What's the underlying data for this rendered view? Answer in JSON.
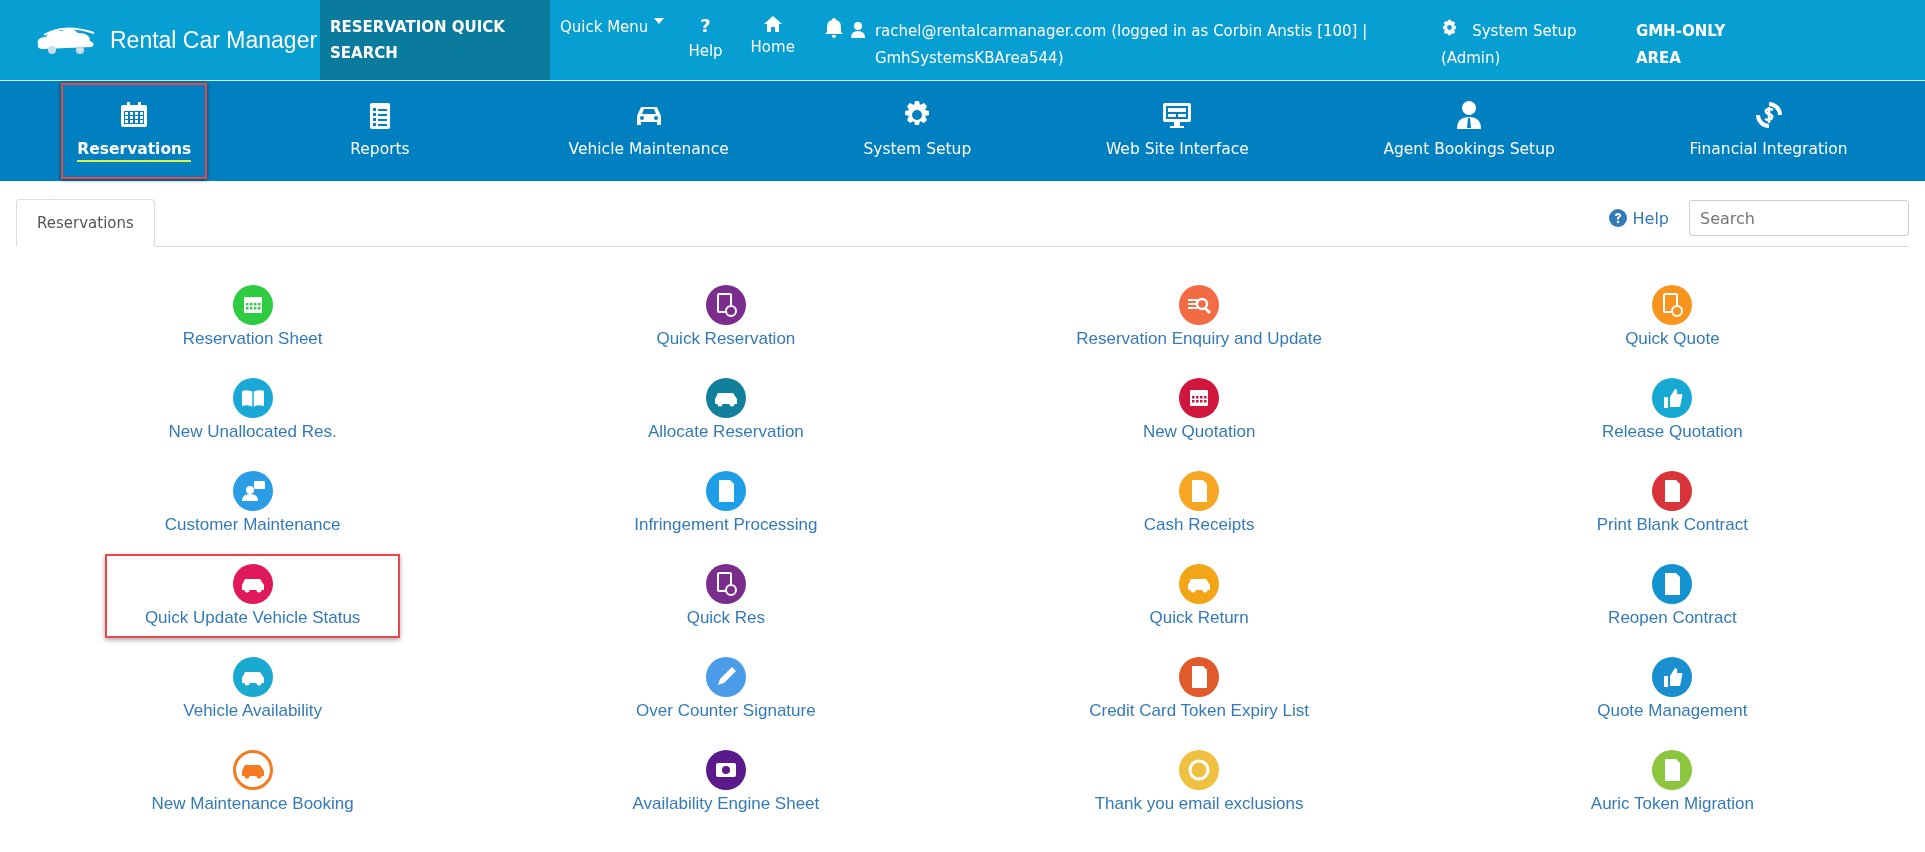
{
  "topbar": {
    "brand": "Rental Car Manager",
    "quick_search": "RESERVATION QUICK SEARCH",
    "quick_menu": "Quick Menu",
    "help_glyph": "?",
    "help": "Help",
    "home": "Home",
    "user": "rachel@rentalcarmanager.com (logged in as Corbin Anstis [100] | GmhSystemsKBArea544)",
    "system_setup": "System Setup (Admin)",
    "area": "GMH-ONLY AREA"
  },
  "nav": [
    {
      "label": "Reservations",
      "selected": true,
      "highlighted": true
    },
    {
      "label": "Reports",
      "selected": false,
      "highlighted": false
    },
    {
      "label": "Vehicle Maintenance",
      "selected": false,
      "highlighted": false
    },
    {
      "label": "System Setup",
      "selected": false,
      "highlighted": false
    },
    {
      "label": "Web Site Interface",
      "selected": false,
      "highlighted": false
    },
    {
      "label": "Agent Bookings Setup",
      "selected": false,
      "highlighted": false
    },
    {
      "label": "Financial Integration",
      "selected": false,
      "highlighted": false
    }
  ],
  "tabs": [
    {
      "label": "Reservations",
      "selected": true
    }
  ],
  "help_link": "Help",
  "search": {
    "placeholder": "Search"
  },
  "menu": [
    [
      {
        "label": "Reservation Sheet",
        "color": "#2ecc40",
        "highlighted": false
      },
      {
        "label": "New Unallocated Res.",
        "color": "#1aa9d6",
        "highlighted": false
      },
      {
        "label": "Customer Maintenance",
        "color": "#2a9de6",
        "highlighted": false
      },
      {
        "label": "Quick Update Vehicle Status",
        "color": "#e0195a",
        "highlighted": true
      },
      {
        "label": "Vehicle Availability",
        "color": "#1aa9d0",
        "highlighted": false
      },
      {
        "label": "New Maintenance Booking",
        "color": "#f47b20",
        "highlighted": false
      }
    ],
    [
      {
        "label": "Quick Reservation",
        "color": "#7b2d8e",
        "highlighted": false
      },
      {
        "label": "Allocate Reservation",
        "color": "#127f9c",
        "highlighted": false
      },
      {
        "label": "Infringement Processing",
        "color": "#1f9ee8",
        "highlighted": false
      },
      {
        "label": "Quick Res",
        "color": "#7b2d8e",
        "highlighted": false
      },
      {
        "label": "Over Counter Signature",
        "color": "#4a9be8",
        "highlighted": false
      },
      {
        "label": "Availability Engine Sheet",
        "color": "#5b1a8c",
        "highlighted": false
      }
    ],
    [
      {
        "label": "Reservation Enquiry and Update",
        "color": "#f26b45",
        "highlighted": false
      },
      {
        "label": "New Quotation",
        "color": "#d0163c",
        "highlighted": false
      },
      {
        "label": "Cash Receipts",
        "color": "#f6a623",
        "highlighted": false
      },
      {
        "label": "Quick Return",
        "color": "#f2a516",
        "highlighted": false
      },
      {
        "label": "Credit Card Token Expiry List",
        "color": "#e05a2b",
        "highlighted": false
      },
      {
        "label": "Thank you email exclusions",
        "color": "#f0c040",
        "highlighted": false
      }
    ],
    [
      {
        "label": "Quick Quote",
        "color": "#f7941d",
        "highlighted": false
      },
      {
        "label": "Release Quotation",
        "color": "#16a9d1",
        "highlighted": false
      },
      {
        "label": "Print Blank Contract",
        "color": "#d9343a",
        "highlighted": false
      },
      {
        "label": "Reopen Contract",
        "color": "#1491cf",
        "highlighted": false
      },
      {
        "label": "Quote Management",
        "color": "#1a8fd0",
        "highlighted": false
      },
      {
        "label": "Auric Token Migration",
        "color": "#8cc63f",
        "highlighted": false
      }
    ]
  ]
}
